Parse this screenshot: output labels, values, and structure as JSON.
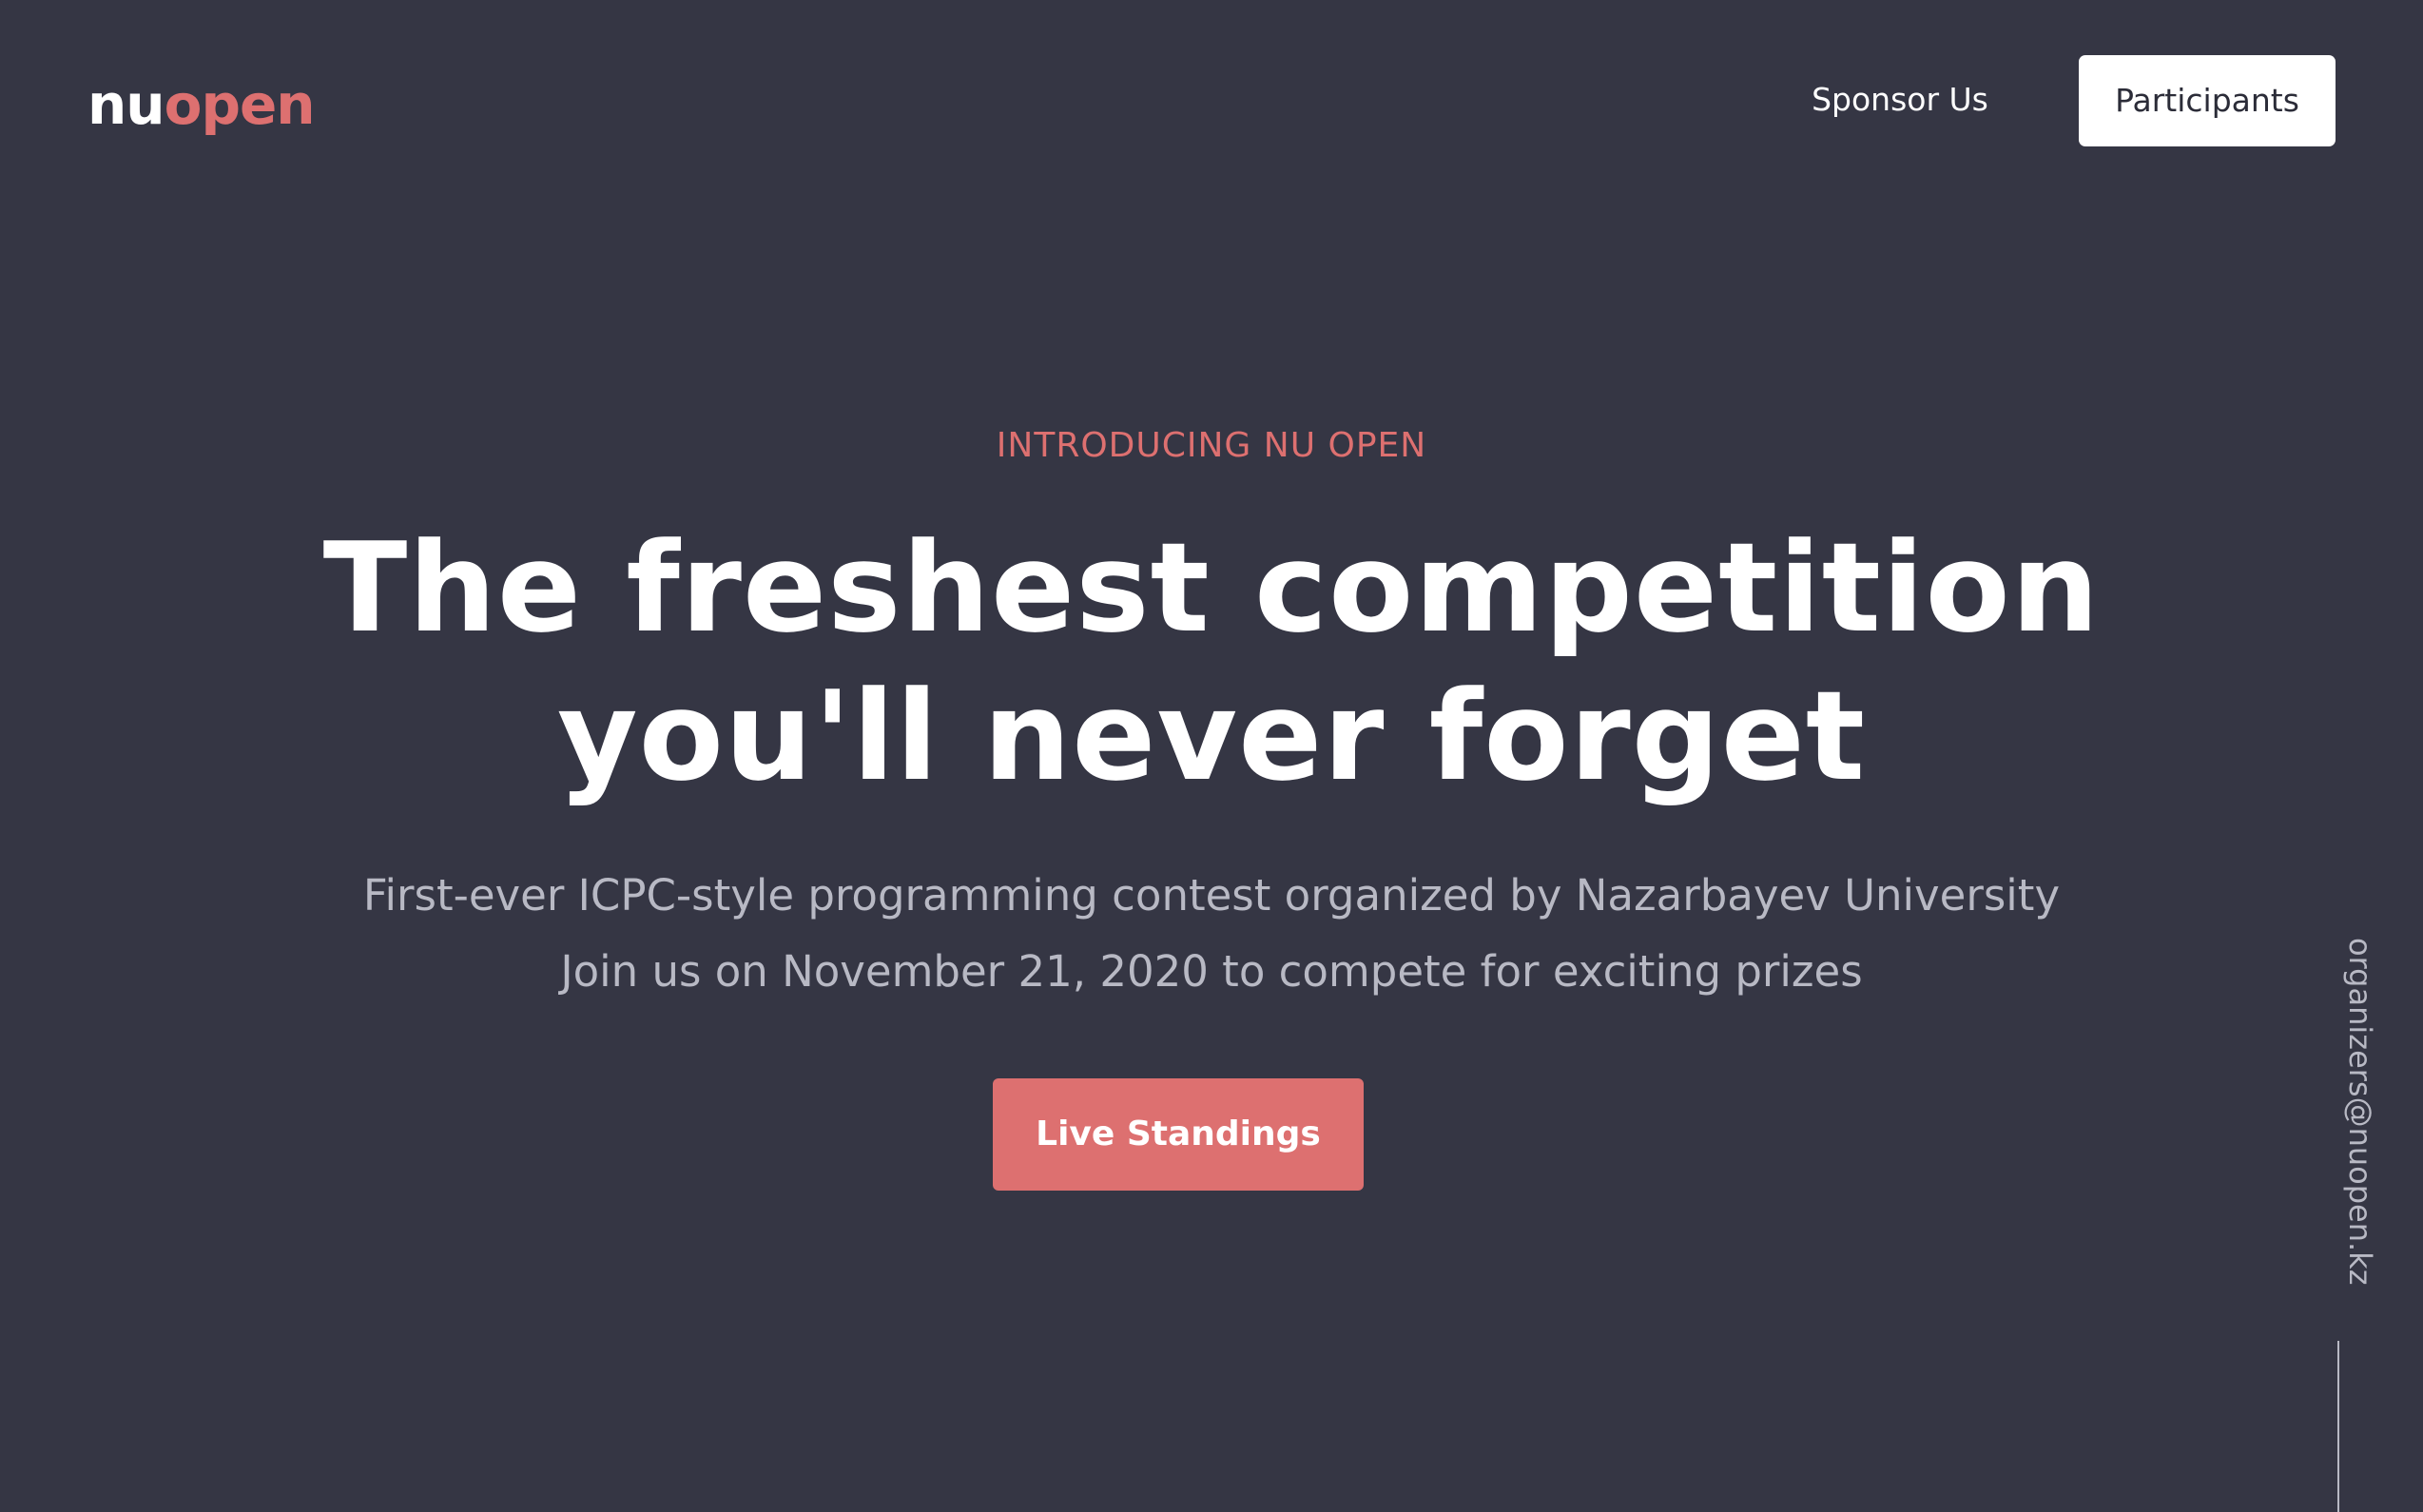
{
  "header": {
    "logo": {
      "part1": "nu",
      "part2": "open"
    },
    "nav": {
      "sponsor_label": "Sponsor Us",
      "participants_label": "Participants"
    }
  },
  "hero": {
    "eyebrow": "INTRODUCING NU OPEN",
    "headline_line1": "The freshest competition",
    "headline_line2": "you'll never forget",
    "subtitle_line1": "First-ever ICPC-style programming contest organized by Nazarbayev University",
    "subtitle_line2": "Join us on November 21, 2020 to compete for exciting prizes",
    "cta_label": "Live Standings"
  },
  "sidebar": {
    "email": "organizers@nuopen.kz"
  },
  "colors": {
    "background": "#353644",
    "accent": "#dd7070",
    "text": "#ffffff",
    "muted": "#b8b9c4"
  }
}
